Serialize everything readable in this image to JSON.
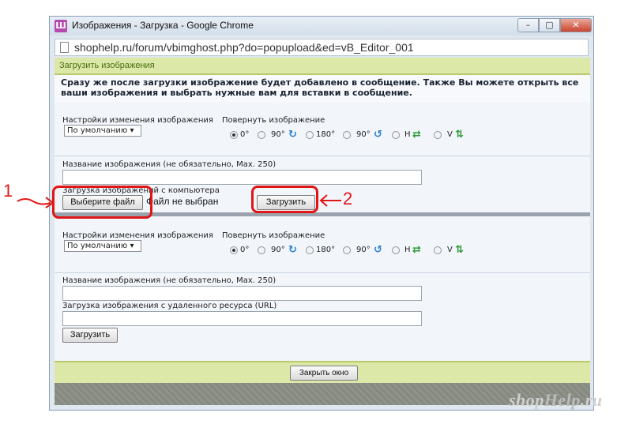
{
  "window": {
    "title": "Изображения - Загрузка - Google Chrome",
    "app_icon": "Ш",
    "controls": {
      "min": "–",
      "max": "▢",
      "close": "✕"
    }
  },
  "address_bar": {
    "url": "shophelp.ru/forum/vbimghost.php?do=popupload&ed=vB_Editor_001"
  },
  "header": {
    "title": "Загрузить изображения"
  },
  "info_text": "Сразу же после загрузки изображение будет добавлено в сообщение. Также Вы можете открыть все ваши изображения и выбрать нужные вам для вставки в сообщение.",
  "block1": {
    "resize_label": "Настройки изменения изображения",
    "resize_value": "По умолчанию",
    "rotate_label": "Повернуть изображение",
    "rotations": [
      "0°",
      "90°",
      "180°",
      "90°",
      "H",
      "V"
    ],
    "selected_rotation": "0°",
    "name_label": "Название изображения (не обязательно, Max. 250)",
    "name_value": "",
    "upload_label": "Загрузка изображений с компьютера",
    "choose_file": "Выберите файл",
    "no_file": "Файл не выбран",
    "upload_button": "Загрузить"
  },
  "block2": {
    "resize_label": "Настройки изменения изображения",
    "resize_value": "По умолчанию",
    "rotate_label": "Повернуть изображение",
    "rotations": [
      "0°",
      "90°",
      "180°",
      "90°",
      "H",
      "V"
    ],
    "selected_rotation": "0°",
    "name_label": "Название изображения (не обязательно, Max. 250)",
    "name_value": "",
    "url_label": "Загрузка изображения с удаленного ресурса (URL)",
    "url_value": "",
    "upload_button": "Загрузить"
  },
  "close_button": "Закрыть окно",
  "annotations": {
    "one": "1",
    "two": "2",
    "color": "#e01616"
  },
  "watermark": {
    "part1": "shop",
    "part2": "Help",
    "part3": ".ru"
  }
}
